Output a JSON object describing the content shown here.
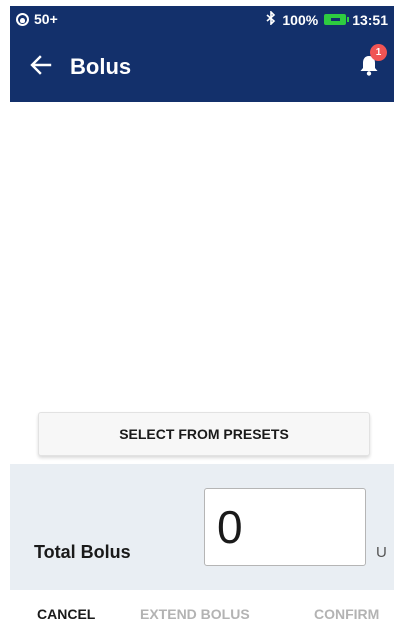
{
  "status_bar": {
    "notification_count_label": "50+",
    "battery_percent": "100%",
    "time": "13:51"
  },
  "app_bar": {
    "title": "Bolus",
    "notification_badge": "1"
  },
  "presets": {
    "button_label": "SELECT FROM PRESETS"
  },
  "total_bolus": {
    "label": "Total Bolus",
    "value": "0",
    "unit": "U"
  },
  "footer": {
    "cancel_label": "CANCEL",
    "extend_label": "EXTEND BOLUS",
    "confirm_label": "CONFIRM"
  },
  "colors": {
    "header_bg": "#13306b",
    "battery_green": "#2ecc40",
    "badge_red": "#f05454",
    "panel_bg": "#e9eef3",
    "disabled_text": "#b3b3b3"
  },
  "icons": [
    "pod-status-icon",
    "bluetooth-icon",
    "battery-icon",
    "back-arrow-icon",
    "bell-icon"
  ]
}
